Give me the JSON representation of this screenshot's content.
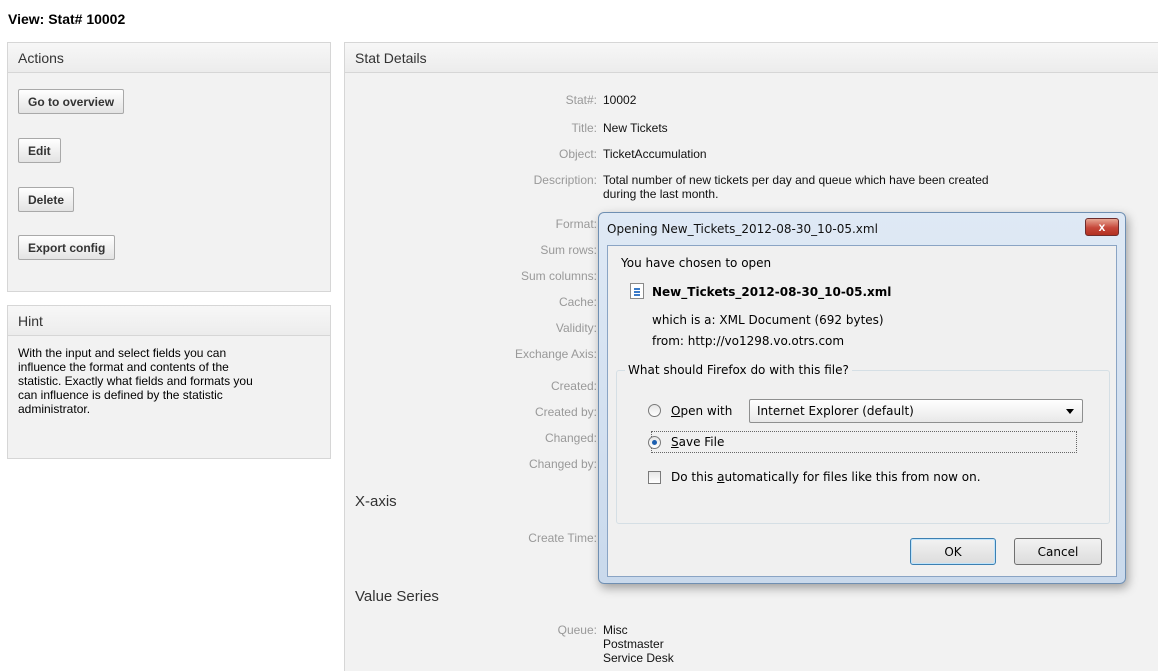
{
  "page": {
    "title": "View: Stat# 10002"
  },
  "actions": {
    "header": "Actions",
    "buttons": {
      "overview": "Go to overview",
      "edit": "Edit",
      "delete": "Delete",
      "export": "Export config"
    }
  },
  "hint": {
    "header": "Hint",
    "lines": [
      "With the input and select fields you can",
      "influence the format and contents of the",
      "statistic. Exactly what fields and formats you",
      "can influence is defined by the statistic",
      "administrator."
    ]
  },
  "details": {
    "header": "Stat Details",
    "fields": {
      "stat_no": {
        "label": "Stat#:",
        "value": "10002"
      },
      "title": {
        "label": "Title:",
        "value": "New Tickets"
      },
      "object": {
        "label": "Object:",
        "value": "TicketAccumulation"
      },
      "description": {
        "label": "Description:",
        "value_line1": "Total number of new tickets per day and queue which have been created",
        "value_line2": "during the last month."
      },
      "format": {
        "label": "Format:"
      },
      "sum_rows": {
        "label": "Sum rows:"
      },
      "sum_columns": {
        "label": "Sum columns:"
      },
      "cache": {
        "label": "Cache:"
      },
      "validity": {
        "label": "Validity:"
      },
      "exchange_axis": {
        "label": "Exchange Axis:"
      },
      "created": {
        "label": "Created:"
      },
      "created_by": {
        "label": "Created by:"
      },
      "changed": {
        "label": "Changed:"
      },
      "changed_by": {
        "label": "Changed by:"
      }
    },
    "xaxis": {
      "heading": "X-axis",
      "create_time_label": "Create Time:"
    },
    "value_series": {
      "heading": "Value Series",
      "queue_label": "Queue:",
      "queues": [
        "Misc",
        "Postmaster",
        "Service Desk"
      ]
    }
  },
  "dialog": {
    "title": "Opening New_Tickets_2012-08-30_10-05.xml",
    "close": "x",
    "intro": "You have chosen to open",
    "filename": "New_Tickets_2012-08-30_10-05.xml",
    "which_is_label": "which is a:",
    "which_is_value": "XML Document (692 bytes)",
    "from_label": "from:",
    "from_value": "http://vo1298.vo.otrs.com",
    "question": "What should Firefox do with this file?",
    "open_with": {
      "key": "O",
      "rest": "pen with"
    },
    "app_select": "Internet Explorer (default)",
    "save_file": {
      "key": "S",
      "rest": "ave File"
    },
    "auto": {
      "before": "Do this ",
      "key": "a",
      "after": "utomatically for files like this from now on."
    },
    "ok": "OK",
    "cancel": "Cancel"
  }
}
